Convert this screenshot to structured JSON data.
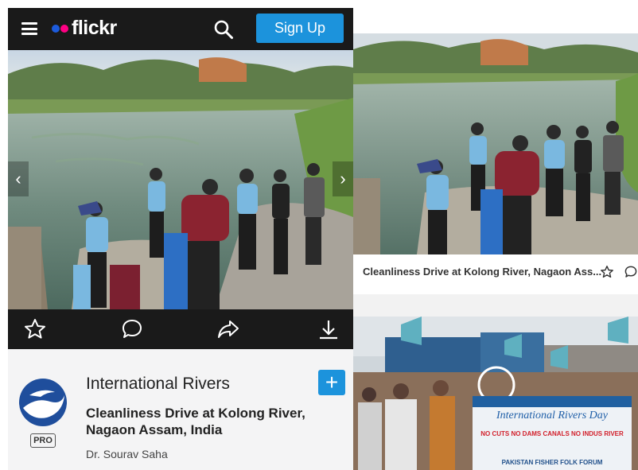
{
  "header": {
    "app_name": "flickr",
    "signup_label": "Sign Up",
    "menu_icon": "hamburger-menu-icon",
    "search_icon": "search-icon",
    "logo_colors": [
      "#1c5bdc",
      "#ff0084"
    ]
  },
  "photo": {
    "prev_icon": "chevron-left-icon",
    "next_icon": "chevron-right-icon",
    "prev_glyph": "‹",
    "next_glyph": "›"
  },
  "actions": {
    "icons": [
      "star-icon",
      "comment-icon",
      "share-icon",
      "download-icon"
    ]
  },
  "info": {
    "group_name": "International Rivers",
    "pro_badge": "PRO",
    "plus_label": "+",
    "title": "Cleanliness Drive at Kolong River, Nagaon Assam, India",
    "author": "Dr. Sourav Saha"
  },
  "feed": {
    "card1_title": "Cleanliness Drive at Kolong River, Nagaon Ass...",
    "card2_banner": "International Rivers Day",
    "card2_slogan": "NO CUTS  NO DAMS  CANALS  NO INDUS RIVER",
    "card2_footer": "PAKISTAN FISHER FOLK FORUM"
  },
  "colors": {
    "accent": "#1c93dc",
    "dark_bar": "#1a1a1a"
  }
}
